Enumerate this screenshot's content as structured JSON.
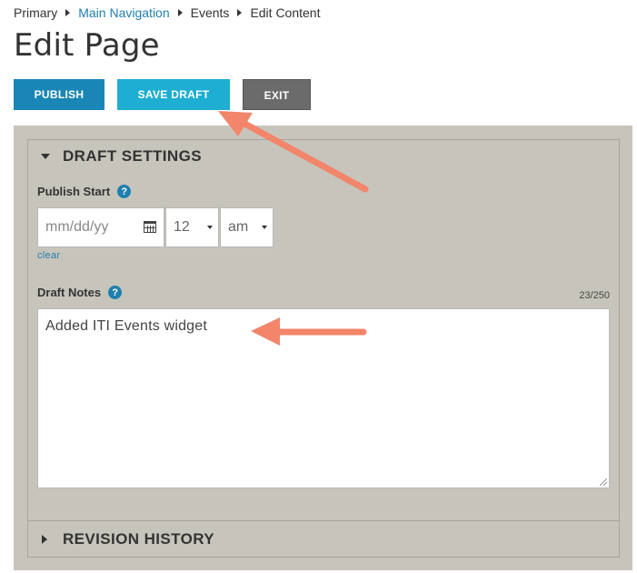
{
  "breadcrumb": {
    "items": [
      "Primary",
      "Main Navigation",
      "Events",
      "Edit Content"
    ]
  },
  "page_title": "Edit Page",
  "toolbar": {
    "publish_label": "PUBLISH",
    "save_draft_label": "SAVE DRAFT",
    "exit_label": "EXIT"
  },
  "draft_settings": {
    "title": "DRAFT SETTINGS",
    "publish_start_label": "Publish Start",
    "date_placeholder": "mm/dd/yy",
    "hour_value": "12",
    "ampm_value": "am",
    "clear_label": "clear",
    "draft_notes_label": "Draft Notes",
    "char_count": "23/250",
    "notes_value": "Added ITI Events widget",
    "help_glyph": "?"
  },
  "revision_history": {
    "title": "REVISION HISTORY"
  },
  "colors": {
    "publish": "#1a86b6",
    "save_draft": "#1eaed1",
    "exit": "#6b6b6b",
    "panel": "#c7c5bb",
    "link": "#1f7fae",
    "annotation_arrow": "#f2856a"
  },
  "icons": [
    "breadcrumb-separator-icon",
    "caret-down-icon",
    "caret-right-icon",
    "help-icon",
    "calendar-icon",
    "select-caret-icon",
    "resize-handle-icon"
  ]
}
